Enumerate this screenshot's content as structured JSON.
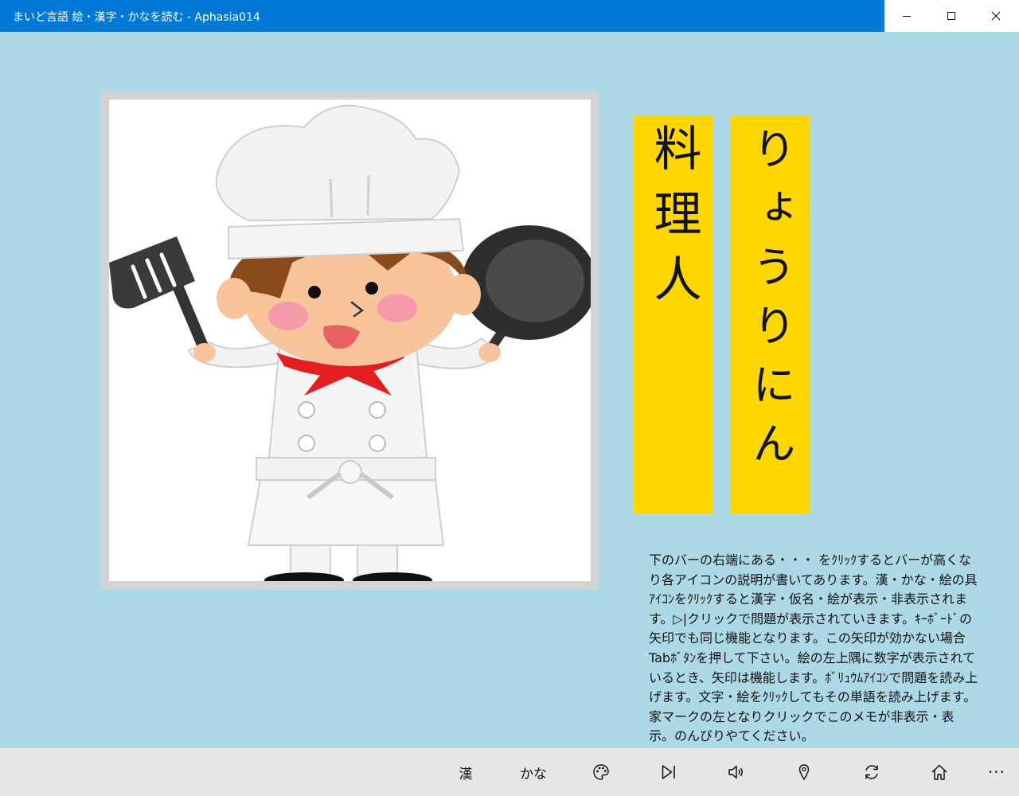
{
  "window": {
    "title": "まいど言語 絵・漢字・かなを読む - Aphasia014"
  },
  "picture": {
    "subject_icon": "chef-illustration"
  },
  "word": {
    "kanji": "料理人",
    "kana": "りょうりにん"
  },
  "memo": {
    "text": "下のバーの右端にある・・・ をｸﾘｯｸするとバーが高くなり各アイコンの説明が書いてあります。漢・かな・絵の具ｱｲｺﾝをｸﾘｯｸすると漢字・仮名・絵が表示・非表示されます。▷|クリックで問題が表示されていきます。ｷｰﾎﾞｰﾄﾞの矢印でも同じ機能となります。この矢印が効かない場合Tabﾎﾞﾀﾝを押して下さい。絵の左上隅に数字が表示されているとき、矢印は機能します。ﾎﾞﾘｭｳﾑｱｲｺﾝで問題を読み上げます。文字・絵をｸﾘｯｸしてもその単語を読み上げます。家マークの左となりクリックでこのメモが非表示・表示。のんびりやてください。"
  },
  "commandbar": {
    "kanji_label": "漢",
    "kana_label": "かな",
    "more_label": "···",
    "icons": [
      "palette-icon",
      "next-track-icon",
      "volume-icon",
      "location-pin-icon",
      "refresh-icon",
      "home-icon"
    ]
  }
}
